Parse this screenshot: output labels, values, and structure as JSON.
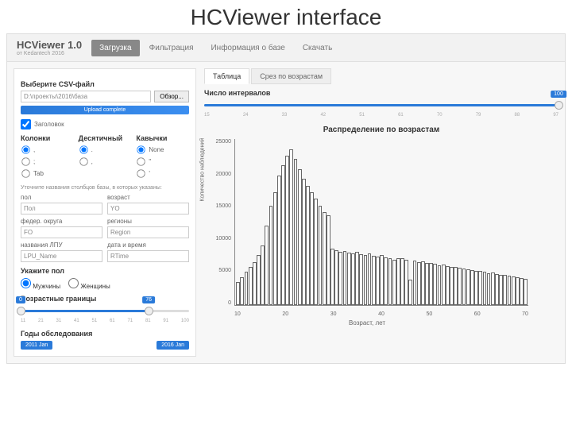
{
  "slide_title": "HCViewer interface",
  "brand": {
    "name": "HCViewer 1.0",
    "sub": "от Kedаntech 2016"
  },
  "nav": {
    "items": [
      {
        "label": "Загрузка",
        "active": true
      },
      {
        "label": "Фильтрация",
        "active": false
      },
      {
        "label": "Информация о базе",
        "active": false
      },
      {
        "label": "Скачать",
        "active": false
      }
    ]
  },
  "sidebar": {
    "choose_file": "Выберите CSV-файл",
    "file_value": "D:\\проекты\\2016\\база",
    "browse": "Обзор...",
    "upload_status": "Upload complete",
    "header_chk": "Заголовок",
    "columns_head": "Колонки",
    "decimal_head": "Десятичный",
    "quotes_head": "Кавычки",
    "col_opts": [
      ",",
      ";",
      "Tab"
    ],
    "dec_opts": [
      ".",
      ","
    ],
    "quote_opts": [
      "None",
      "\"",
      "'"
    ],
    "note": "Уточните названия столбцов базы, в которых указаны:",
    "fields": {
      "pol_lbl": "пол",
      "pol_val": "Пол",
      "age_lbl": "возраст",
      "age_val": "YO",
      "fo_lbl": "федер. округа",
      "fo_val": "FO",
      "reg_lbl": "регионы",
      "reg_val": "Region",
      "lpu_lbl": "названия ЛПУ",
      "lpu_val": "LPU_Name",
      "dt_lbl": "дата и время",
      "dt_val": "RTime"
    },
    "gender_head": "Укажите пол",
    "gender": {
      "m": "Мужчины",
      "f": "Женщины"
    },
    "age_bounds_head": "Возрастные границы",
    "age_slider": {
      "min": 0,
      "max": 100,
      "lo": 0,
      "hi": 76,
      "ticks": [
        "11",
        "21",
        "31",
        "41",
        "51",
        "61",
        "71",
        "81",
        "91",
        "100"
      ]
    },
    "years_head": "Годы обследования",
    "years": {
      "from": "2011 Jan",
      "to": "2016 Jan"
    }
  },
  "content": {
    "tabs": [
      {
        "label": "Таблица",
        "active": true
      },
      {
        "label": "Срез по возрастам",
        "active": false
      }
    ],
    "interval_head": "Число интервалов",
    "interval_slider": {
      "min": 0,
      "max": 100,
      "val": 100,
      "ticks": [
        "15",
        "24",
        "33",
        "42",
        "51",
        "61",
        "70",
        "79",
        "88",
        "97"
      ]
    }
  },
  "chart_data": {
    "type": "bar",
    "title": "Распределение по возрастам",
    "xlabel": "Возраст, лет",
    "ylabel": "Количество наблюдений",
    "ylim": [
      0,
      25000
    ],
    "y_ticks": [
      "25000",
      "20000",
      "15000",
      "10000",
      "5000",
      "0"
    ],
    "x_ticks": [
      "10",
      "20",
      "30",
      "40",
      "50",
      "60",
      "70"
    ],
    "x": [
      4,
      5,
      6,
      7,
      8,
      9,
      10,
      11,
      12,
      13,
      14,
      15,
      16,
      17,
      18,
      19,
      20,
      21,
      22,
      23,
      24,
      25,
      26,
      27,
      28,
      29,
      30,
      31,
      32,
      33,
      34,
      35,
      36,
      37,
      38,
      39,
      40,
      41,
      42,
      43,
      44,
      45,
      46,
      47,
      48,
      49,
      50,
      51,
      52,
      53,
      54,
      55,
      56,
      57,
      58,
      59,
      60,
      61,
      62,
      63,
      64,
      65,
      66,
      67,
      68,
      69,
      70,
      71,
      72,
      73,
      74
    ],
    "values": [
      3500,
      4200,
      5000,
      5800,
      6500,
      7500,
      9000,
      12000,
      15000,
      17000,
      19500,
      21000,
      22500,
      23500,
      22000,
      20500,
      19000,
      18000,
      17000,
      16000,
      15000,
      14000,
      13500,
      8500,
      8200,
      8000,
      8100,
      7900,
      7800,
      8000,
      7600,
      7500,
      7800,
      7400,
      7300,
      7500,
      7200,
      7000,
      6800,
      7100,
      7000,
      6800,
      3800,
      6700,
      6500,
      6600,
      6400,
      6300,
      6200,
      6000,
      6100,
      5900,
      5800,
      5700,
      5600,
      5500,
      5400,
      5300,
      5200,
      5100,
      5000,
      4800,
      4900,
      4700,
      4600,
      4500,
      4400,
      4300,
      4200,
      4100,
      4000
    ]
  }
}
